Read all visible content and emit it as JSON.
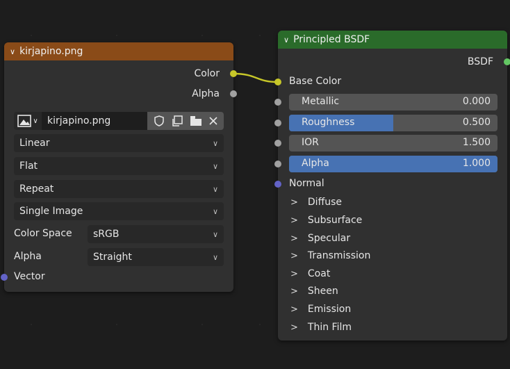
{
  "image_node": {
    "title": "kirjapino.png",
    "header_color": "#8a4b18",
    "outputs": [
      {
        "label": "Color",
        "socket_color": "#c7c729"
      },
      {
        "label": "Alpha",
        "socket_color": "#a1a1a1"
      }
    ],
    "image_name": "kirjapino.png",
    "interpolation": "Linear",
    "projection": "Flat",
    "extension": "Repeat",
    "source": "Single Image",
    "color_space_label": "Color Space",
    "color_space_value": "sRGB",
    "alpha_label": "Alpha",
    "alpha_value": "Straight",
    "vector_input": "Vector"
  },
  "bsdf_node": {
    "title": "Principled BSDF",
    "header_color": "#2a6b2a",
    "output": "BSDF",
    "base_color": "Base Color",
    "sliders": [
      {
        "label": "Metallic",
        "value": "0.000",
        "fill": 0.0
      },
      {
        "label": "Roughness",
        "value": "0.500",
        "fill": 0.5
      },
      {
        "label": "IOR",
        "value": "1.500",
        "fill": 0.0
      },
      {
        "label": "Alpha",
        "value": "1.000",
        "fill": 1.0
      }
    ],
    "normal": "Normal",
    "panels": [
      "Diffuse",
      "Subsurface",
      "Specular",
      "Transmission",
      "Coat",
      "Sheen",
      "Emission",
      "Thin Film"
    ]
  },
  "icons": {
    "collapse": "chevron-down-icon",
    "panel": "chevron-right-icon",
    "image_type": "image-icon",
    "fake_user": "shield-icon",
    "duplicate": "duplicate-icon",
    "open": "folder-icon",
    "unlink": "close-icon"
  }
}
